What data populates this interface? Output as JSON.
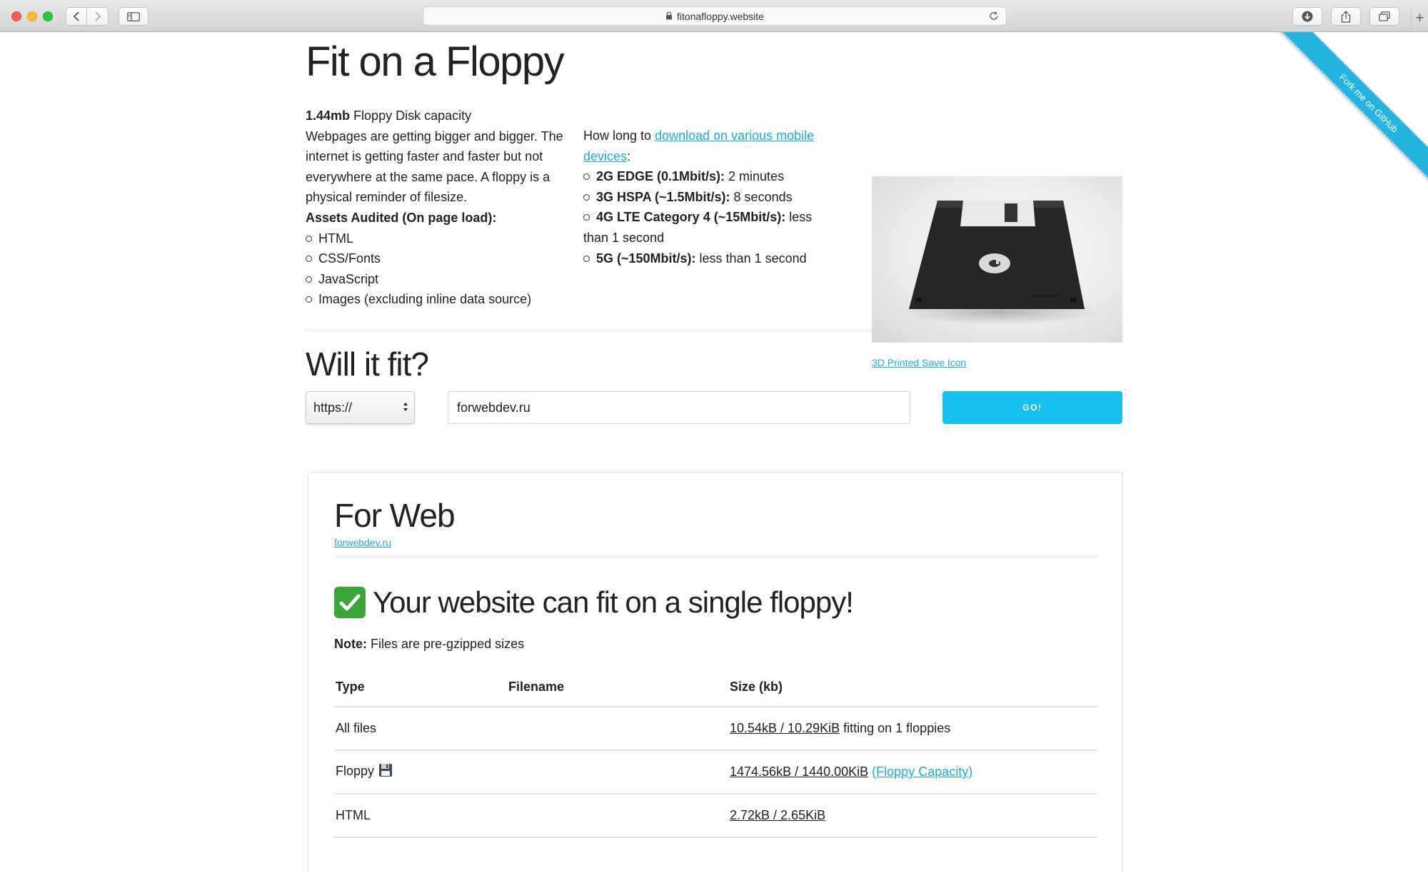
{
  "browser": {
    "url": "fitonafloppy.website"
  },
  "ribbon": {
    "label": "Fork me on GitHub"
  },
  "header": {
    "title": "Fit on a Floppy"
  },
  "intro": {
    "capacity_bold": "1.44mb",
    "capacity_rest": " Floppy Disk capacity",
    "description": "Webpages are getting bigger and bigger. The internet is getting faster and faster but not everywhere at the same pace. A floppy is a physical reminder of filesize.",
    "assets_heading": "Assets Audited (On page load):",
    "assets": [
      "HTML",
      "CSS/Fonts",
      "JavaScript",
      "Images (excluding inline data source)"
    ],
    "howlong_prefix": "How long to ",
    "howlong_link": "download on various mobile devices",
    "howlong_suffix": ":",
    "speeds": [
      {
        "label": "2G EDGE (0.1Mbit/s):",
        "value": " 2 minutes"
      },
      {
        "label": "3G HSPA (~1.5Mbit/s):",
        "value": " 8 seconds"
      },
      {
        "label": "4G LTE Category 4 (~15Mbit/s):",
        "value": " less than 1 second"
      },
      {
        "label": "5G (~150Mbit/s):",
        "value": " less than 1 second"
      }
    ],
    "photo_caption": "3D Printed Save Icon"
  },
  "form": {
    "heading": "Will it fit?",
    "protocol": "https://",
    "url_value": "forwebdev.ru",
    "go_label": "GO!"
  },
  "result": {
    "title": "For Web",
    "site_link": "forwebdev.ru",
    "verdict": "Your website can fit on a single floppy!",
    "note_bold": "Note:",
    "note_rest": " Files are pre-gzipped sizes",
    "table": {
      "headers": [
        "Type",
        "Filename",
        "Size (kb)"
      ],
      "rows": [
        {
          "type": "All files",
          "filename": "",
          "size": "10.54kB / 10.29KiB",
          "extra": " fitting on 1 floppies"
        },
        {
          "type": "Floppy",
          "filename": "",
          "size": "1474.56kB / 1440.00KiB",
          "extra": "(Floppy Capacity)"
        },
        {
          "type": "HTML",
          "filename": "",
          "size": "2.72kB / 2.65KiB",
          "extra": ""
        }
      ]
    }
  },
  "colors": {
    "accent": "#1EAEDB",
    "button": "#19C0EE",
    "ribbon": "#24B4DF",
    "check": "#3AA63A"
  },
  "icons": [
    "back-icon",
    "forward-icon",
    "sidebar-icon",
    "lock-icon",
    "reload-icon",
    "download-icon",
    "share-icon",
    "tabs-icon",
    "new-tab-icon",
    "check-mark-icon",
    "floppy-disk-icon"
  ]
}
